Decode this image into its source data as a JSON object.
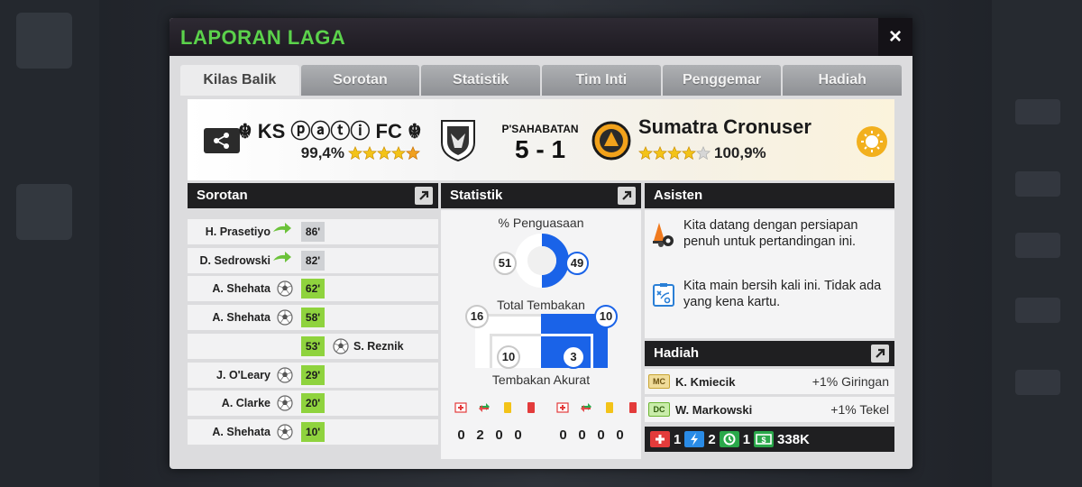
{
  "modal": {
    "title": "LAPORAN LAGA",
    "close_label": "×"
  },
  "tabs": [
    {
      "label": "Kilas Balik",
      "active": true
    },
    {
      "label": "Sorotan",
      "active": false
    },
    {
      "label": "Statistik",
      "active": false
    },
    {
      "label": "Tim Inti",
      "active": false
    },
    {
      "label": "Penggemar",
      "active": false
    },
    {
      "label": "Hadiah",
      "active": false
    }
  ],
  "match": {
    "home_name": "☬ KS ⓟⓐⓣⓘ FC ☬",
    "home_rating": "99,4%",
    "home_stars": 4.5,
    "match_type": "P'SAHABATAN",
    "score": "5 - 1",
    "away_name": "Sumatra Cronuser",
    "away_rating": "100,9%",
    "away_stars": 4
  },
  "highlights": {
    "title": "Sorotan",
    "rows": [
      {
        "side": "home",
        "player": "H. Prasetiyo",
        "minute": "86'",
        "type": "sub"
      },
      {
        "side": "home",
        "player": "D. Sedrowski",
        "minute": "82'",
        "type": "sub"
      },
      {
        "side": "home",
        "player": "A. Shehata",
        "minute": "62'",
        "type": "goal"
      },
      {
        "side": "home",
        "player": "A. Shehata",
        "minute": "58'",
        "type": "goal"
      },
      {
        "side": "away",
        "player": "S. Reznik",
        "minute": "53'",
        "type": "goal"
      },
      {
        "side": "home",
        "player": "J. O'Leary",
        "minute": "29'",
        "type": "goal"
      },
      {
        "side": "home",
        "player": "A. Clarke",
        "minute": "20'",
        "type": "goal"
      },
      {
        "side": "home",
        "player": "A. Shehata",
        "minute": "10'",
        "type": "goal"
      }
    ]
  },
  "stats": {
    "title": "Statistik",
    "possession_label": "% Penguasaan",
    "possession_home": "51",
    "possession_away": "49",
    "shots_label": "Total Tembakan",
    "shots_home": "16",
    "shots_away": "10",
    "on_target_label": "Tembakan Akurat",
    "on_target_home": "10",
    "on_target_away": "3",
    "home_cards": [
      "0",
      "2",
      "0",
      "0"
    ],
    "away_cards": [
      "0",
      "0",
      "0",
      "0"
    ]
  },
  "assistant": {
    "title": "Asisten",
    "messages": [
      {
        "icon": "cones-icon",
        "text": "Kita datang dengan persiapan penuh untuk pertandingan ini."
      },
      {
        "icon": "tactics-board-icon",
        "text": "Kita main bersih kali ini. Tidak ada yang kena kartu."
      }
    ]
  },
  "rewards": {
    "title": "Hadiah",
    "players": [
      {
        "position": "MC",
        "name": "K. Kmiecik",
        "bonus": "+1% Giringan",
        "badge_color": "#e9c35a"
      },
      {
        "position": "DC",
        "name": "W. Markowski",
        "bonus": "+1% Tekel",
        "badge_color": "#8fd33e"
      }
    ],
    "currencies": [
      {
        "icon": "medical-icon",
        "value": "1",
        "color": "#e33b3b"
      },
      {
        "icon": "energy-icon",
        "value": "2",
        "color": "#2a8be6"
      },
      {
        "icon": "training-icon",
        "value": "1",
        "color": "#2aa84a"
      },
      {
        "icon": "money-icon",
        "value": "338K",
        "color": "#2aa84a"
      }
    ]
  },
  "colors": {
    "title_green": "#5bd24b",
    "away_blue": "#1a63e8",
    "goal_green": "#8fd33e"
  }
}
